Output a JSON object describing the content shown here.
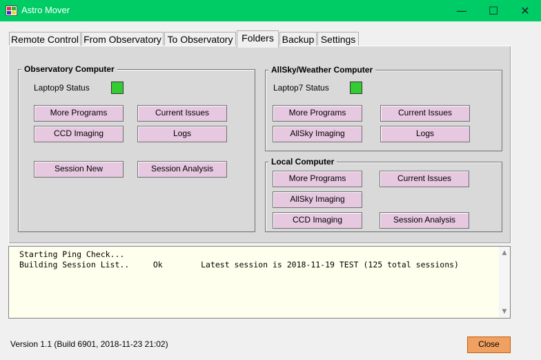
{
  "window": {
    "title": "Astro Mover",
    "minimize_glyph": "—",
    "maximize_glyph": "☐",
    "close_glyph": "✕"
  },
  "tabs": [
    {
      "label": "Remote Control"
    },
    {
      "label": "From Observatory"
    },
    {
      "label": "To Observatory"
    },
    {
      "label": "Folders"
    },
    {
      "label": "Backup"
    },
    {
      "label": "Settings"
    }
  ],
  "active_tab": "Folders",
  "observatory": {
    "title": "Observatory Computer",
    "status_label": "Laptop9 Status",
    "status_color": "#33cc33",
    "buttons": [
      "More Programs",
      "Current Issues",
      "CCD Imaging",
      "Logs",
      "Session New",
      "Session Analysis"
    ]
  },
  "allsky": {
    "title": "AllSky/Weather Computer",
    "status_label": "Laptop7 Status",
    "status_color": "#33cc33",
    "buttons": [
      "More Programs",
      "Current Issues",
      "AllSky Imaging",
      "Logs"
    ]
  },
  "local": {
    "title": "Local Computer",
    "buttons": [
      "More Programs",
      "Current Issues",
      "AllSky Imaging",
      "CCD Imaging",
      "Session Analysis"
    ]
  },
  "log": {
    "lines": [
      "Starting Ping Check...",
      "Building Session List..     Ok        Latest session is 2018-11-19 TEST (125 total sessions)"
    ]
  },
  "status": {
    "version_text": "Version  1.1  (Build 6901, 2018-11-23 21:02)"
  },
  "close_button": {
    "label": "Close",
    "color": "#f0a060"
  }
}
